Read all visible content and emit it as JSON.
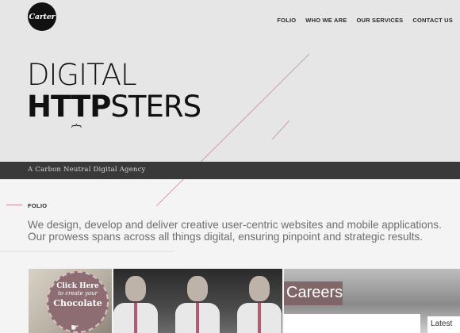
{
  "brand": {
    "logo_text": "Carter"
  },
  "nav": {
    "items": [
      "FOLIO",
      "WHO WE ARE",
      "OUR SERVICES",
      "CONTACT US"
    ]
  },
  "hero": {
    "headline_line1": "DIGITAL",
    "headline_line2_bold": "HTTP",
    "headline_line2_light": "STERS",
    "brace": "{"
  },
  "tagline": "A Carbon Neutral Digital Agency",
  "folio": {
    "label": "FOLIO",
    "intro": "We design, develop and deliver creative user-centric websites and mobile applications. Our prowess spans across all things digital, ensuring pinpoint and strategic results."
  },
  "tiles": {
    "chocolate": {
      "top": "Click Here",
      "sub": "to create your",
      "main": "Chocolate"
    },
    "careers": {
      "title": "Careers",
      "latest": "Latest"
    }
  },
  "colors": {
    "accent": "#c98a9a",
    "tagbar": "#393939",
    "badge": "#8d6c72"
  }
}
